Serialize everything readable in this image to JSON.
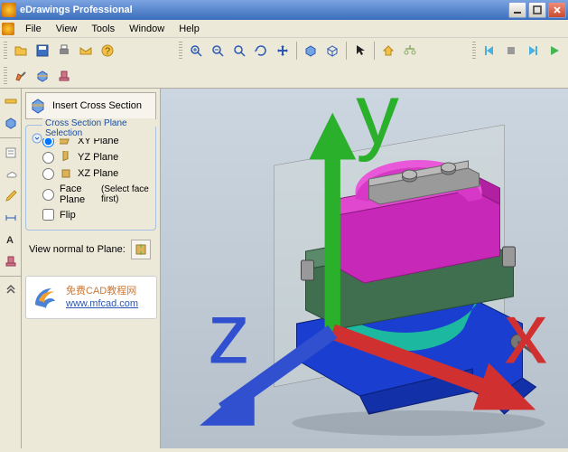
{
  "window": {
    "title": "eDrawings Professional"
  },
  "menubar": {
    "file": "File",
    "view": "View",
    "tools": "Tools",
    "window": "Window",
    "help": "Help"
  },
  "panel": {
    "header_label": "Insert Cross Section",
    "group_title": "Cross Section Plane Selection",
    "xy": "XY Plane",
    "yz": "YZ Plane",
    "xz": "XZ Plane",
    "face": "Face Plane",
    "face_note": "(Select face first)",
    "flip": "Flip",
    "view_normal": "View normal to Plane:"
  },
  "watermark": {
    "line1": "免费CAD教程网",
    "line2": "www.mfcad.com"
  },
  "triad": {
    "x": "x",
    "y": "y",
    "z": "z"
  }
}
